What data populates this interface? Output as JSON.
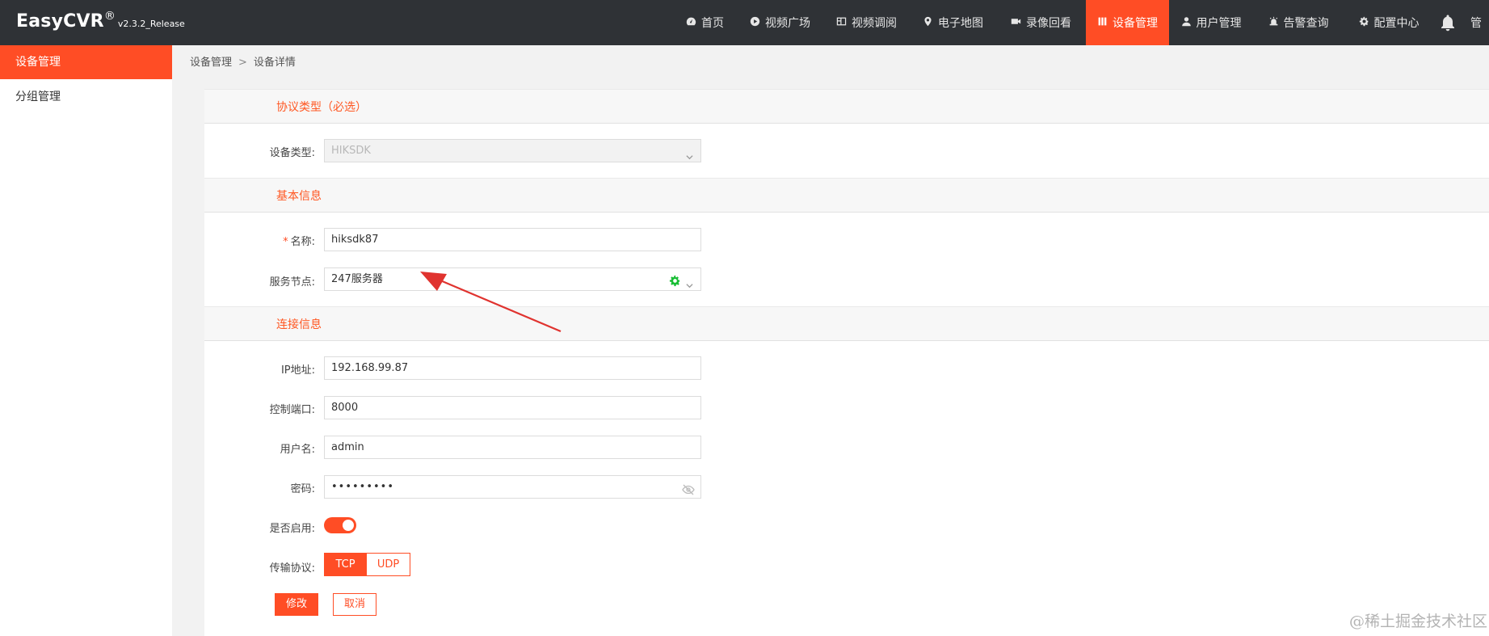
{
  "app": {
    "name": "EasyCVR",
    "reg": "®",
    "version": "v2.3.2_Release"
  },
  "nav": [
    {
      "label": "首页",
      "icon": "dashboard-icon",
      "active": false
    },
    {
      "label": "视频广场",
      "icon": "play-circle-icon",
      "active": false
    },
    {
      "label": "视频调阅",
      "icon": "grid-icon",
      "active": false
    },
    {
      "label": "电子地图",
      "icon": "map-pin-icon",
      "active": false
    },
    {
      "label": "录像回看",
      "icon": "video-camera-icon",
      "active": false
    },
    {
      "label": "设备管理",
      "icon": "device-icon",
      "active": true
    },
    {
      "label": "用户管理",
      "icon": "user-icon",
      "active": false
    },
    {
      "label": "告警查询",
      "icon": "alarm-icon",
      "active": false
    },
    {
      "label": "配置中心",
      "icon": "gear-icon",
      "active": false
    }
  ],
  "header_user_text": "管",
  "sidebar": {
    "items": [
      {
        "label": "设备管理",
        "active": true
      },
      {
        "label": "分组管理",
        "active": false
      }
    ]
  },
  "breadcrumb": {
    "parent": "设备管理",
    "sep": ">",
    "current": "设备详情"
  },
  "sections": {
    "protocol": "协议类型（必选）",
    "basic": "基本信息",
    "connection": "连接信息"
  },
  "form": {
    "device_type": {
      "label": "设备类型:",
      "value": "HIKSDK"
    },
    "name": {
      "required_mark": "*",
      "label": "名称:",
      "value": "hiksdk87"
    },
    "service_node": {
      "label": "服务节点:",
      "value": "247服务器"
    },
    "ip": {
      "label": "IP地址:",
      "value": "192.168.99.87"
    },
    "port": {
      "label": "控制端口:",
      "value": "8000"
    },
    "username": {
      "label": "用户名:",
      "value": "admin"
    },
    "password": {
      "label": "密码:",
      "value": "•••••••••"
    },
    "enabled": {
      "label": "是否启用:",
      "on": true
    },
    "transport": {
      "label": "传输协议:",
      "options": [
        "TCP",
        "UDP"
      ],
      "selected": "TCP"
    }
  },
  "buttons": {
    "submit": "修改",
    "cancel": "取消"
  },
  "watermark": "@稀土掘金技术社区",
  "colors": {
    "accent": "#ff4d25",
    "header_bg": "#2f3236",
    "status_ok": "#19be35",
    "annotation_arrow": "#e0332f"
  }
}
